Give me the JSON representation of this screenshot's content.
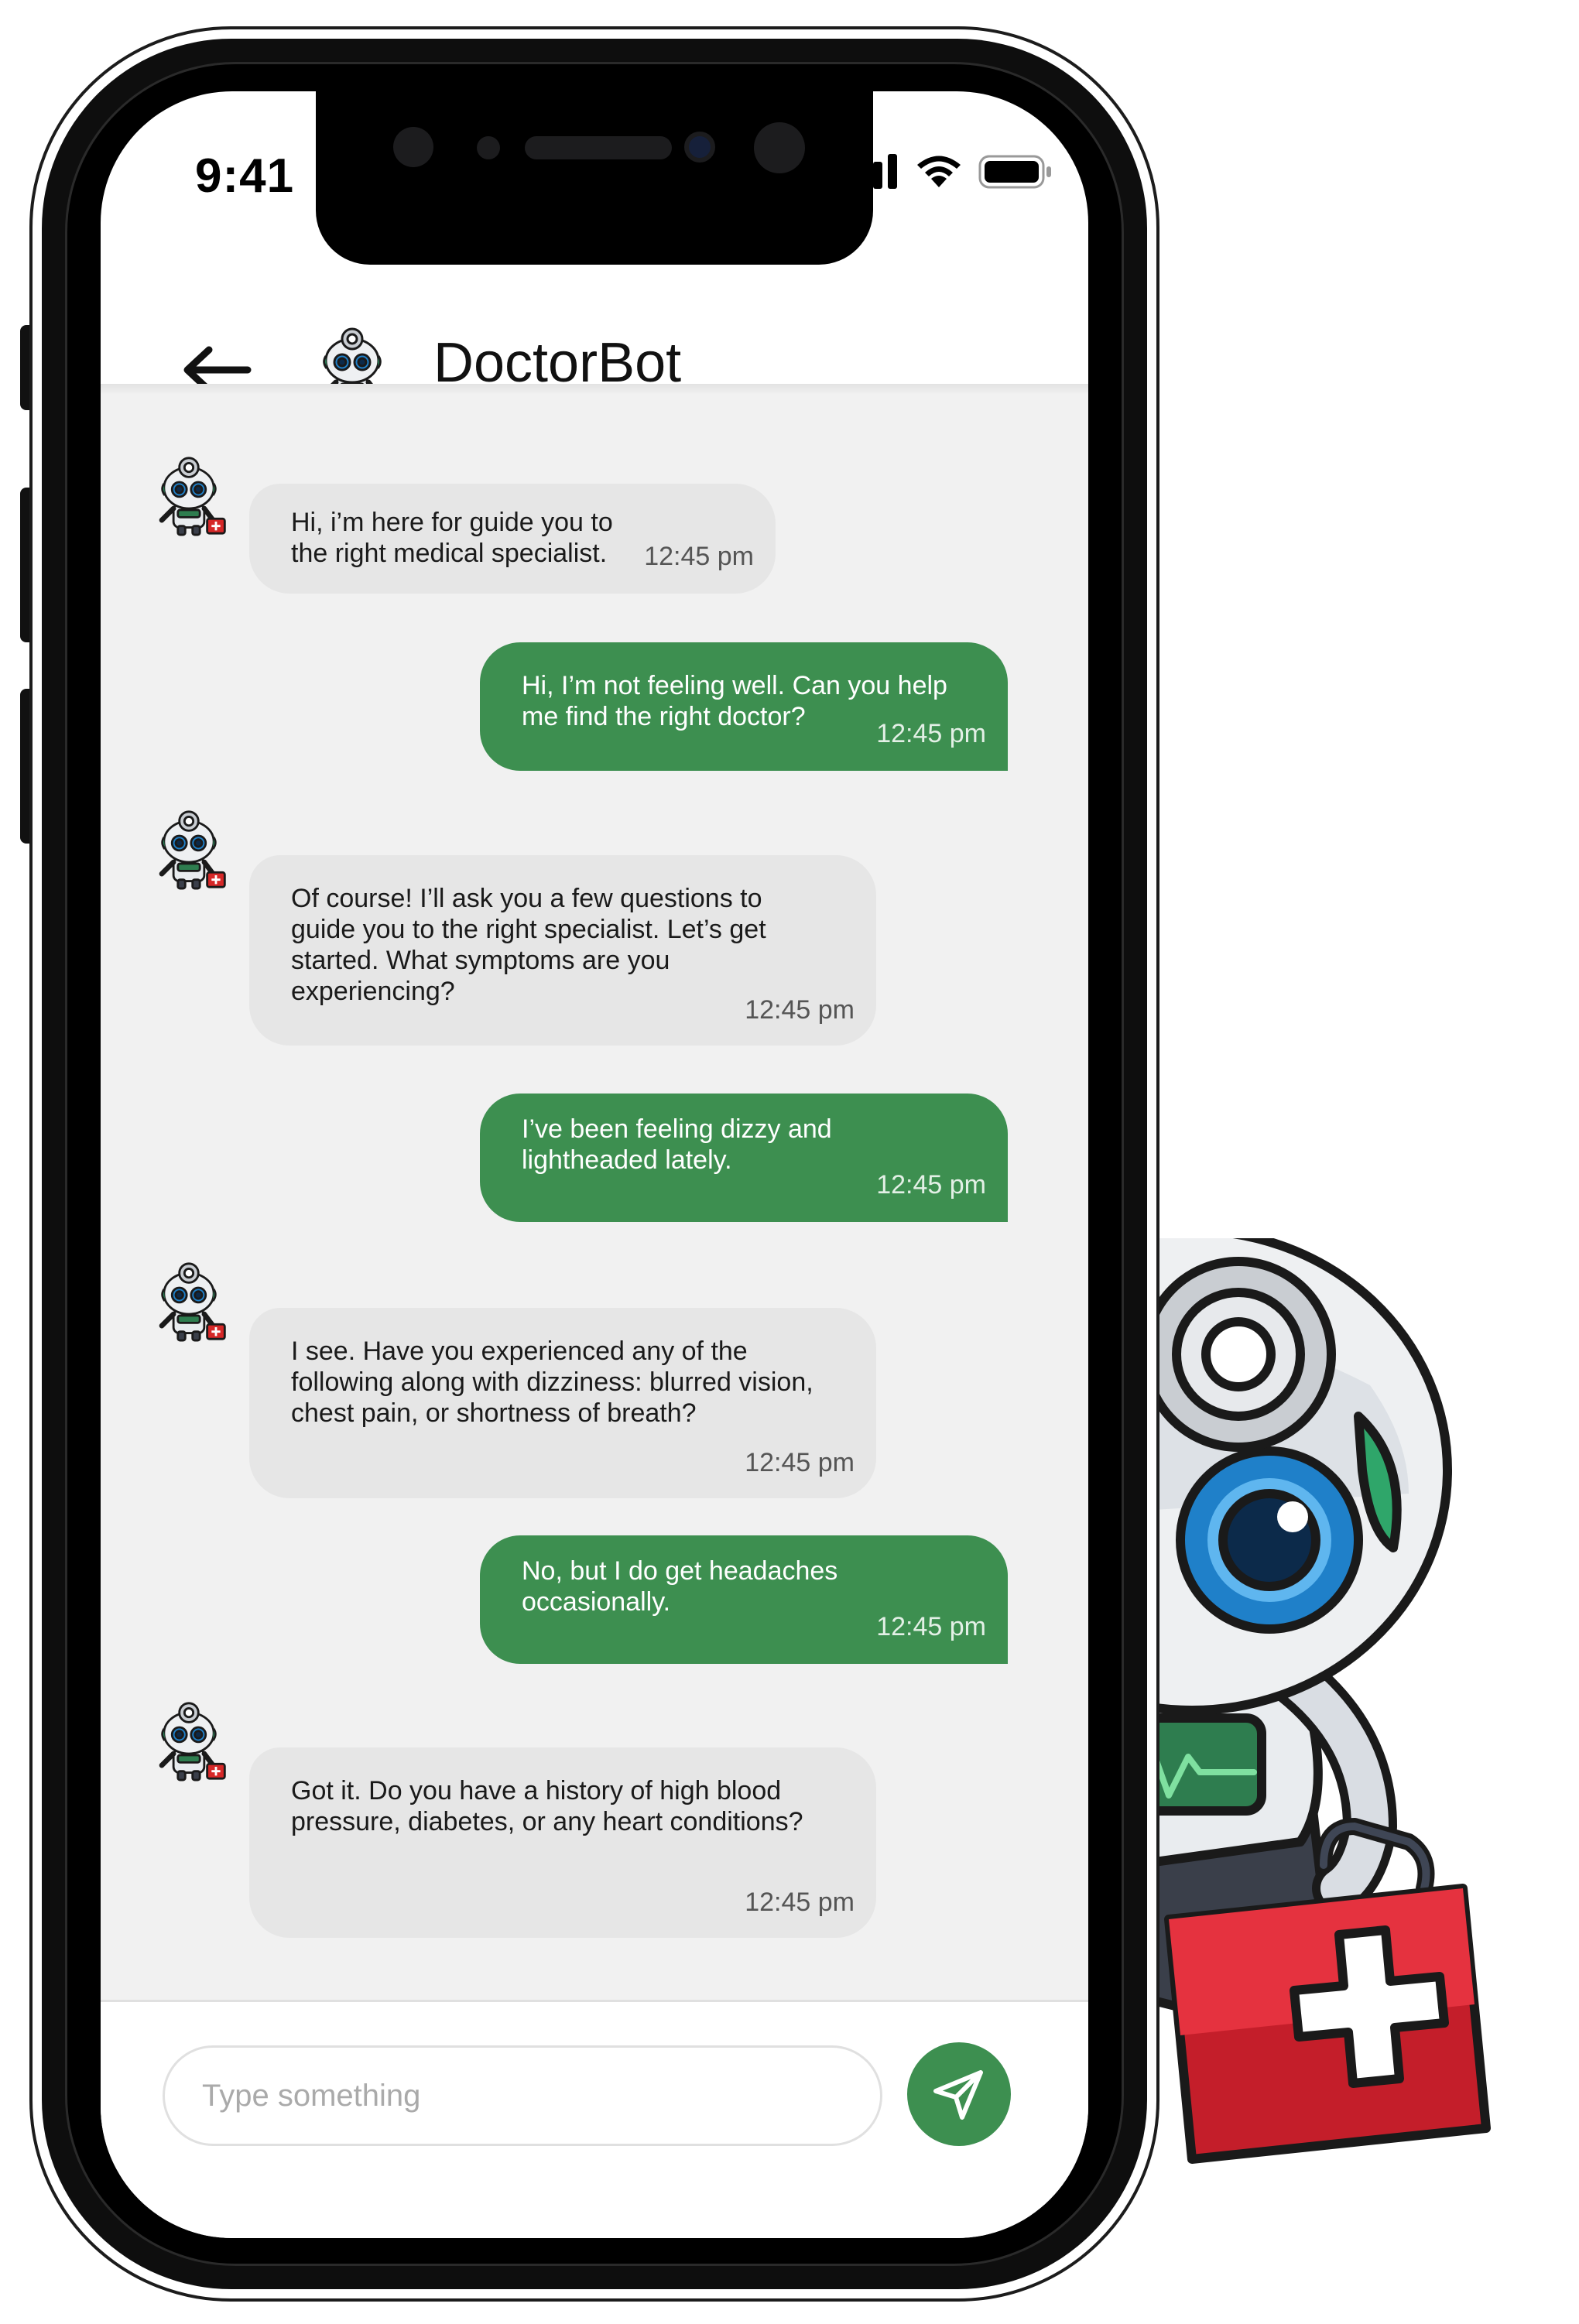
{
  "status_bar": {
    "time": "9:41",
    "icons": [
      "signal-icon",
      "wifi-icon",
      "battery-icon"
    ]
  },
  "header": {
    "back_icon": "arrow-left-icon",
    "bot_name": "DoctorBot"
  },
  "messages": [
    {
      "sender": "bot",
      "text": "Hi, i’m here for guide you to\nthe right medical specialist.",
      "time": "12:45 pm"
    },
    {
      "sender": "user",
      "text": "Hi, I’m not feeling well. Can you help\nme find the right doctor?",
      "time": "12:45 pm"
    },
    {
      "sender": "bot",
      "text": "Of course! I’ll ask you a few questions to\nguide you to the right specialist. Let’s get\nstarted. What symptoms are you\nexperiencing?",
      "time": "12:45 pm"
    },
    {
      "sender": "user",
      "text": "I’ve been feeling dizzy and\nlightheaded lately.",
      "time": "12:45 pm"
    },
    {
      "sender": "bot",
      "text": "I see. Have you experienced any of the\nfollowing along with dizziness: blurred vision,\nchest pain, or shortness of breath?",
      "time": "12:45 pm"
    },
    {
      "sender": "user",
      "text": "No, but I do get headaches\noccasionally.",
      "time": "12:45 pm"
    },
    {
      "sender": "bot",
      "text": "Got it. Do you have a history of high blood\npressure, diabetes, or any heart conditions?",
      "time": "12:45 pm"
    }
  ],
  "composer": {
    "placeholder": "Type something",
    "value": "",
    "send_icon": "send-icon"
  },
  "colors": {
    "accent": "#3d8f50",
    "bot_bubble": "#e6e6e6",
    "chat_background": "#f1f1f1",
    "medkit_red": "#d62828"
  }
}
